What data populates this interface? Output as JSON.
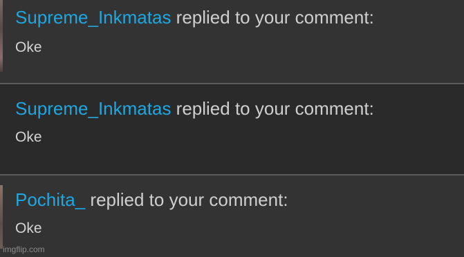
{
  "notifications": [
    {
      "username": "Supreme_Inkmatas",
      "action": " replied to your comment:",
      "comment": "Oke"
    },
    {
      "username": "Supreme_Inkmatas",
      "action": " replied to your comment:",
      "comment": "Oke"
    },
    {
      "username": "Pochita_",
      "action": " replied to your comment:",
      "comment": "Oke"
    }
  ],
  "watermark": "imgflip.com",
  "colors": {
    "username": "#1ea7e1",
    "text": "#cfcfcf",
    "background": "#333333",
    "background_alt": "#2a2a2a",
    "divider": "#5a5a5a"
  }
}
